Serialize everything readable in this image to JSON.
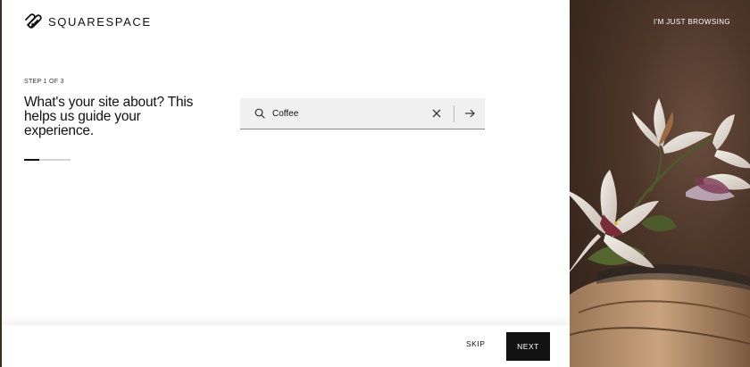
{
  "brand": {
    "name": "SQUARESPACE",
    "icon": "squarespace-logo-icon"
  },
  "onboarding": {
    "step_label": "STEP 1 OF 3",
    "question": "What's your site about? This helps us guide your experience.",
    "progress": 0.33
  },
  "search": {
    "value": "Coffee",
    "placeholder": "",
    "icons": {
      "search": "search-icon",
      "clear": "close-icon",
      "submit": "arrow-right-icon"
    }
  },
  "footer": {
    "skip_label": "SKIP",
    "next_label": "NEXT"
  },
  "side_panel": {
    "browse_label": "I'M JUST BROWSING",
    "image": "flower-photo"
  },
  "colors": {
    "accent": "#111111",
    "input_bg": "#f0f0f0",
    "panel_bg": "#4b3528"
  }
}
